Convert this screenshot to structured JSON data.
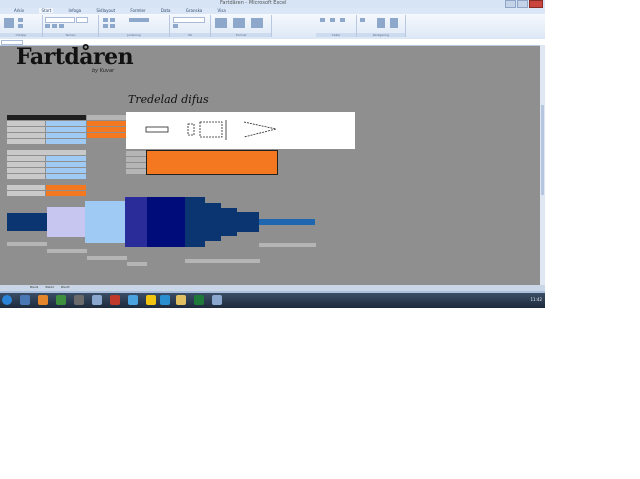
{
  "window": {
    "title": "Fartdåren - Microsoft Excel"
  },
  "ribbon_tabs": [
    "Arkiv",
    "Start",
    "Infoga",
    "Sidlayout",
    "Formler",
    "Data",
    "Granska",
    "Visa"
  ],
  "ribbon_groups": [
    "Urklipp",
    "Tecken",
    "Justering",
    "Tal",
    "Format",
    "Celler",
    "Redigering"
  ],
  "sheet": {
    "logo_text": "Fartdåren",
    "logo_subtext": "by Kuvar",
    "heading": "Tredelad difus",
    "sheet_tabs": [
      "Blad1",
      "Blad2",
      "Blad3"
    ]
  },
  "taskbar": {
    "clock": "11:42"
  },
  "colors": {
    "sheet_bg": "#8f8f8f",
    "orange": "#f47820",
    "light_blue": "#9fcaf4",
    "navy": "#000c7a",
    "dark_blue": "#0b3570"
  }
}
